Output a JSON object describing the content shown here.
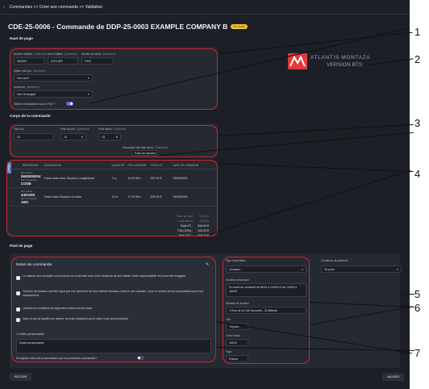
{
  "breadcrumb": {
    "back": "‹",
    "text": "Commandes >> Créer une commande >> Validation"
  },
  "page": {
    "title": "CDE-25-0006 - Commande de DDP-25-0003 EXAMPLE COMPANY B",
    "badge": "En cours"
  },
  "logo": {
    "brand": "ATLANTIS MONTAZA",
    "sub": "VERSION BTS"
  },
  "haut": {
    "section": "Haut de page",
    "fields": [
      {
        "label": "Numéro d'affaire",
        "opt": "(Optionnel)",
        "value": "554353"
      },
      {
        "label": "Nom d'affaire",
        "opt": "(Optionnel)",
        "value": "ATELIER"
      },
      {
        "label": "Numéro de devis",
        "opt": "(Optionnel)",
        "value": "F920"
      }
    ],
    "suivi": {
      "label": "Affaire suivi par",
      "opt": "(Optionnel)",
      "value": "Non suivi"
    },
    "incoterm": {
      "label": "Incoterms",
      "opt": "(Optionnel)",
      "value": "Non renseigné"
    },
    "pdf": {
      "label": "Afficher la déclaration dans le PDF ?"
    }
  },
  "corps": {
    "section": "Corps de la commande",
    "tva": {
      "label": "Taux (%)",
      "value": "20"
    },
    "port": {
      "label": "Frais de port",
      "opt": "(Optionnel)",
      "value": "10",
      "unit": "€"
    },
    "divers": {
      "label": "Frais divers",
      "opt": "(Optionnel)",
      "value": "15",
      "unit": "€"
    },
    "desc": {
      "label": "Description des frais divers",
      "opt": "(Optionnel)",
      "value": "Frais de douane"
    }
  },
  "table": {
    "headers": [
      "RÉFÉRENCE",
      "DÉSIGNATION",
      "QUANTITÉ",
      "PRIX UNITAIRE",
      "TOTAL HT",
      "DATE DE LIVRAISON"
    ],
    "rows": [
      {
        "interne_lbl": "Réf. interne",
        "interne": "5600000004",
        "fourn_lbl": "Réf. fournisseur",
        "fourn": "CODE",
        "designation": "Tubes Acier avec Soudure Longitudinal",
        "qty": "7 m",
        "pu": "41.00 €/m",
        "total": "287.00 €",
        "date": "05/06/2025"
      },
      {
        "interne_lbl": "Réf. interne",
        "interne": "4401393",
        "fourn_lbl": "Réf. fournisseur",
        "fourn": "ABC",
        "designation": "Tubes sans Soudure en Acier",
        "qty": "12 m",
        "pu": "17.00 €/m",
        "total": "204.00 €",
        "date": "05/06/2025"
      }
    ],
    "side_label": "REMISE",
    "totals": [
      {
        "label": "Frais de port :",
        "value": "10.00 €"
      },
      {
        "label": "Frais divers :",
        "value": "15.00 €"
      },
      {
        "label": "Total HT :",
        "value": "516.00 €"
      },
      {
        "label": "TVA (20%) :",
        "value": "103.20 €"
      },
      {
        "label": "Total TTC :",
        "value": "619.20 €"
      }
    ]
  },
  "pied": {
    "section": "Pied de page",
    "notes_title": "Notes de commande",
    "notes": [
      "La matière sera acceptée sous réserve de conformité avec notre demande de prix initiale. Notre responsabilité ne pourra être engagée.",
      "Tout bon de livraison doit être signé par une personne de chez Atlantis Montaza. Dans le cas contraire, nous ne serions tenus responsables pour tout manquement.",
      "Livraison et conditions de règlement suivant accord cadre.",
      "Dans le cas de qualité non avérée, les frais refacturés par le client vous seront imputés."
    ],
    "perso_label": "Notes personnalisée",
    "perso_value": "Notes personnalisé",
    "reuse_label": "Enregistrer cette note personnalisée pour les prochaines commandes ?",
    "expedition": {
      "label": "Type d'expédition",
      "value": "Livraison"
    },
    "paiement": {
      "label": "Conditions de paiement",
      "value": "30 jours"
    },
    "horaires": {
      "label": "Horaires de livraison",
      "value": "Du lundi au vendredi de 8h00 à 12h00 et de 13h00 à 16h30"
    },
    "adresse": {
      "label": "Adresse de livraison",
      "value": "1 Rue de la Cité Nouvelle - ZI Attitude"
    },
    "ville": {
      "label": "Ville",
      "value": "Thyelec"
    },
    "cp": {
      "label": "Code Postal",
      "value": "44370"
    },
    "pays": {
      "label": "Pays",
      "value": "France"
    }
  },
  "buttons": {
    "retour": "RETOUR",
    "valider": "VALIDER"
  },
  "callouts": [
    "1",
    "2",
    "3",
    "4",
    "5",
    "6",
    "7"
  ]
}
